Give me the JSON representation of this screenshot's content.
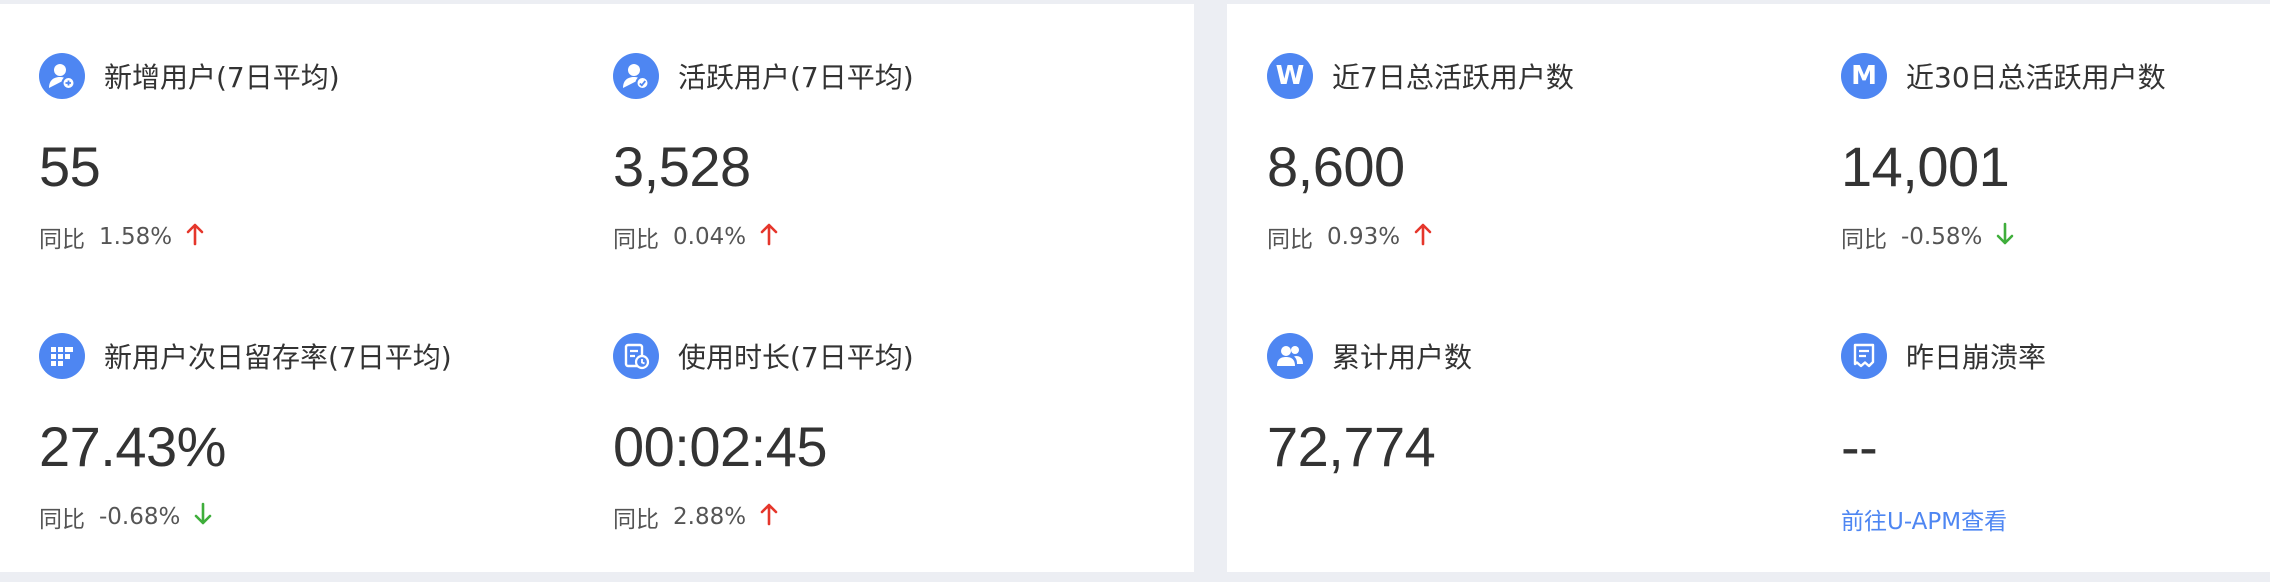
{
  "colors": {
    "accent": "#4e86f2",
    "up": "#e5362b",
    "down": "#3fae3b"
  },
  "left_panel": {
    "cards": [
      {
        "label": "新增用户(7日平均)",
        "icon": "user-add-icon",
        "value": "55",
        "compare_label": "同比",
        "compare_value": "1.58%",
        "trend": "up"
      },
      {
        "label": "活跃用户(7日平均)",
        "icon": "user-active-icon",
        "value": "3,528",
        "compare_label": "同比",
        "compare_value": "0.04%",
        "trend": "up"
      },
      {
        "label": "新用户次日留存率(7日平均)",
        "icon": "grid-icon",
        "value": "27.43%",
        "compare_label": "同比",
        "compare_value": "-0.68%",
        "trend": "down"
      },
      {
        "label": "使用时长(7日平均)",
        "icon": "clock-doc-icon",
        "value": "00:02:45",
        "compare_label": "同比",
        "compare_value": "2.88%",
        "trend": "up"
      }
    ]
  },
  "right_panel": {
    "cards": [
      {
        "label": "近7日总活跃用户数",
        "icon_letter": "W",
        "value": "8,600",
        "compare_label": "同比",
        "compare_value": "0.93%",
        "trend": "up"
      },
      {
        "label": "近30日总活跃用户数",
        "icon_letter": "M",
        "value": "14,001",
        "compare_label": "同比",
        "compare_value": "-0.58%",
        "trend": "down"
      },
      {
        "label": "累计用户数",
        "icon": "users-icon",
        "value": "72,774"
      },
      {
        "label": "昨日崩溃率",
        "icon": "crash-doc-icon",
        "value": "--",
        "link": "前往U-APM查看"
      }
    ]
  }
}
